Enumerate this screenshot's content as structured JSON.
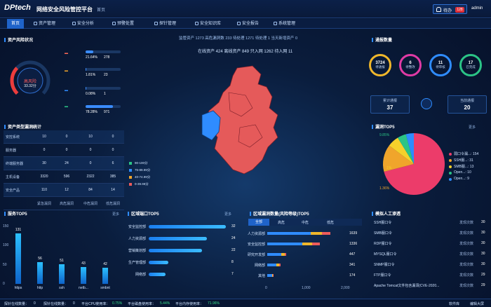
{
  "header": {
    "logo": "DPtech",
    "title": "网络安全风险管控平台",
    "home": "首页",
    "notify_label": "待办",
    "notify_badge": "128",
    "user": "admin"
  },
  "nav": [
    {
      "label": "首页",
      "active": true
    },
    {
      "label": "资产管理"
    },
    {
      "label": "安全分析"
    },
    {
      "label": "预警处置"
    },
    {
      "label": "探针管理"
    },
    {
      "label": "安全知识库"
    },
    {
      "label": "安全报告"
    },
    {
      "label": "系统管理"
    }
  ],
  "risk": {
    "title": "资产风险状况",
    "gauge_label": "高风险",
    "gauge_value": "33.32分",
    "gauge_progress": 0.33,
    "rows": [
      {
        "pct": "21.64%",
        "num": "278",
        "fill": 0.22,
        "color": "#3a8cff"
      },
      {
        "pct": "1.81%",
        "num": "23",
        "fill": 0.02,
        "color": "#3a8cff"
      },
      {
        "pct": "0.08%",
        "num": "1",
        "fill": 0.01,
        "color": "#3a8cff"
      },
      {
        "pct": "78.28%",
        "num": "971",
        "fill": 0.78,
        "color": "#3a8cff"
      }
    ]
  },
  "asset_table": {
    "title": "资产类型漏洞统计",
    "rows": [
      {
        "name": "安控系统",
        "v": [
          "10",
          "0",
          "10",
          "0"
        ]
      },
      {
        "name": "服务器",
        "v": [
          "0",
          "0",
          "0",
          "0"
        ]
      },
      {
        "name": "终端服务器",
        "v": [
          "30",
          "24",
          "0",
          "6"
        ]
      },
      {
        "name": "主机设备",
        "v": [
          "3320",
          "596",
          "2322",
          "385"
        ]
      },
      {
        "name": "安全产品",
        "v": [
          "110",
          "12",
          "84",
          "14"
        ]
      }
    ],
    "footer": [
      "紧急漏洞",
      "高危漏洞",
      "中危漏洞",
      "低危漏洞"
    ]
  },
  "center": {
    "stats": "监管资产 1273  高危漏洞数 233  待处理 1271  待处理 1  当天新增资产 0",
    "stats2": "在线资产 424  离线资产 849  只入网 1262  待入网 11",
    "legend": [
      {
        "label": "90-100分",
        "color": "#2bc486"
      },
      {
        "label": "75-89.99分",
        "color": "#2f8cff"
      },
      {
        "label": "40-74.99分",
        "color": "#f0a52b"
      },
      {
        "label": "0-39.99分",
        "color": "#ec5b5b"
      }
    ]
  },
  "notice": {
    "title": "通报数量",
    "circles": [
      {
        "value": "3724",
        "label": "待通报",
        "color": "#f0b72b"
      },
      {
        "value": "6",
        "label": "待整改",
        "color": "#e03aa5"
      },
      {
        "value": "11",
        "label": "待审核",
        "color": "#2f8cff"
      },
      {
        "value": "17",
        "label": "已完成",
        "color": "#2bc486"
      }
    ],
    "box_left": {
      "label": "累计通报",
      "value": "37"
    },
    "box_right": {
      "label": "当前通报",
      "value": "20"
    }
  },
  "vuln_top": {
    "title": "漏洞TOP5",
    "more": "更多",
    "chart_data": {
      "type": "pie",
      "labels": [
        "弱口令漏...",
        "SSH服...",
        "SMB服...",
        "Open...",
        "Open..."
      ],
      "values": [
        154,
        31,
        13,
        10,
        9
      ],
      "colors": [
        "#ec3c6a",
        "#f0a52b",
        "#f5d12b",
        "#2bc486",
        "#2f8cff"
      ],
      "slice_labels": [
        "9.85%",
        "1%",
        "1.36%"
      ],
      "legend_values": [
        "154",
        "31",
        "13",
        "10",
        "9"
      ]
    }
  },
  "service_top": {
    "title": "服务TOP5",
    "more": "更多",
    "chart_data": {
      "type": "bar",
      "categories": [
        "https",
        "http",
        "ssh",
        "netb...",
        "smbnt"
      ],
      "values": [
        131,
        56,
        51,
        43,
        42
      ],
      "ylim": [
        0,
        150
      ],
      "yticks": [
        "150",
        "100",
        "50",
        "0"
      ]
    }
  },
  "port_top": {
    "title": "区域端口TOP5",
    "more": "更多",
    "rows": [
      {
        "label": "安全监控部",
        "value": 32,
        "shown": "32"
      },
      {
        "label": "人力资源部",
        "value": 24,
        "shown": "24"
      },
      {
        "label": "营销策划部",
        "value": 22,
        "shown": "22"
      },
      {
        "label": "生产管理部",
        "value": 8,
        "shown": "8"
      },
      {
        "label": "网络部",
        "value": 7,
        "shown": "7"
      }
    ],
    "max": 32
  },
  "level_top": {
    "title": "区域漏洞数量(风险等级)TOP5",
    "tabs": [
      "全部",
      "高危",
      "中危",
      "低危"
    ],
    "rows": [
      {
        "label": "人力资源部",
        "total": "1639",
        "segs": [
          0.55,
          0.15,
          0.1
        ]
      },
      {
        "label": "安全监控部",
        "total": "1336",
        "segs": [
          0.45,
          0.12,
          0.1
        ]
      },
      {
        "label": "研究开发部",
        "total": "447",
        "segs": [
          0.18,
          0.04,
          0.02
        ]
      },
      {
        "label": "网络部",
        "total": "341",
        "segs": [
          0.12,
          0.03,
          0.02
        ]
      },
      {
        "label": "其他",
        "total": "174",
        "segs": [
          0.06,
          0.01,
          0.01
        ]
      }
    ],
    "axis": [
      "0",
      "1,000",
      "2,000"
    ],
    "max": 2000,
    "colors": [
      "#2f8cff",
      "#f0b72b",
      "#ec5b5b"
    ]
  },
  "manual": {
    "title": "模拟人工渗透",
    "rows": [
      {
        "name": "SSH服口令",
        "status": "发现次数",
        "count": "30"
      },
      {
        "name": "SMB服口令",
        "status": "发现次数",
        "count": "30"
      },
      {
        "name": "RDP服口令",
        "status": "发现次数",
        "count": "30"
      },
      {
        "name": "MYSQL服口令",
        "status": "发现次数",
        "count": "30"
      },
      {
        "name": "SNMP服口令",
        "status": "发现次数",
        "count": "30"
      },
      {
        "name": "FTP服口令",
        "status": "发现次数",
        "count": "29"
      },
      {
        "name": "Apache Tomcat文件包含漏洞(CVE-2020...",
        "status": "发现次数",
        "count": "29"
      }
    ]
  },
  "statusbar": {
    "online": "探针在线数量：",
    "online_v": "0",
    "offline": "探针在线数量：",
    "offline_v": "0",
    "cpu": "平台CPU使用率：",
    "cpu_v": "0.75%",
    "disk": "平台磁盘使用率：",
    "disk_v": "5.44%",
    "mem": "平台内存使用率：",
    "mem_v": "71.96%",
    "right1": "软件库",
    "right2": "编辑大屏"
  }
}
